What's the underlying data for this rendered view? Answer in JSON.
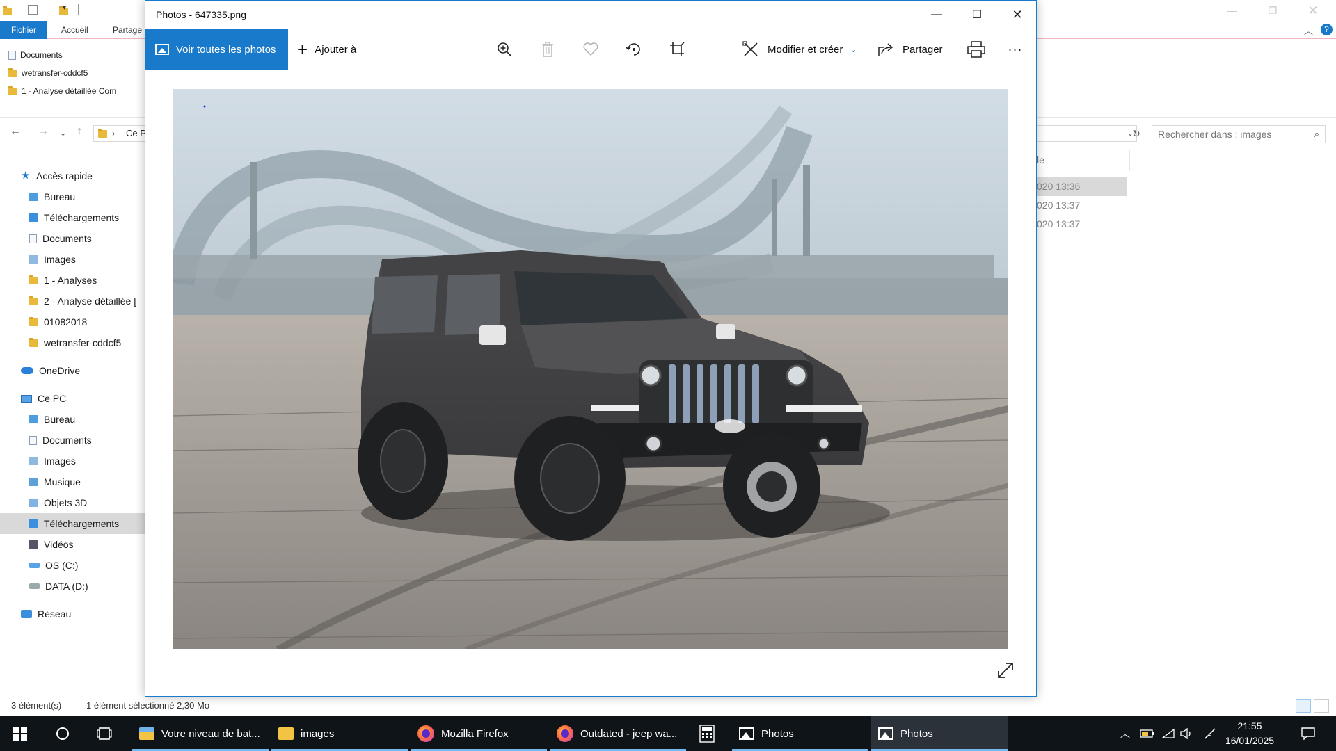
{
  "explorer": {
    "tabs": {
      "file": "Fichier",
      "home": "Accueil",
      "share": "Partage"
    },
    "recent": [
      "Documents",
      "wetransfer-cddcf5",
      "1 - Analyse détaillée Com"
    ],
    "address": "Ce P",
    "search_placeholder": "Rechercher dans : images",
    "tree": {
      "quick_access": "Accès rapide",
      "quick_items": [
        "Bureau",
        "Téléchargements",
        "Documents",
        "Images",
        "1 - Analyses",
        "2 - Analyse détaillée [",
        "01082018",
        "wetransfer-cddcf5"
      ],
      "onedrive": "OneDrive",
      "this_pc": "Ce PC",
      "pc_items": [
        "Bureau",
        "Documents",
        "Images",
        "Musique",
        "Objets 3D",
        "Téléchargements",
        "Vidéos",
        "OS (C:)",
        "DATA (D:)"
      ],
      "network": "Réseau"
    },
    "list": {
      "column_header": "le",
      "dates": [
        "020 13:36",
        "020 13:37",
        "020 13:37"
      ]
    },
    "status": {
      "count": "3 élément(s)",
      "selected": "1 élément sélectionné  2,30 Mo"
    }
  },
  "photos": {
    "title": "Photos - 647335.png",
    "view_all": "Voir toutes les photos",
    "add_to": "Ajouter à",
    "edit_create": "Modifier et créer",
    "share": "Partager",
    "more": "···"
  },
  "taskbar": {
    "apps": [
      "Votre niveau de bat...",
      "images",
      "Mozilla Firefox",
      "Outdated - jeep wa...",
      "Photos",
      "Photos"
    ],
    "time": "21:55",
    "date": "16/01/2025"
  },
  "colors": {
    "accent": "#1979ca",
    "taskbar": "#0f1419"
  }
}
